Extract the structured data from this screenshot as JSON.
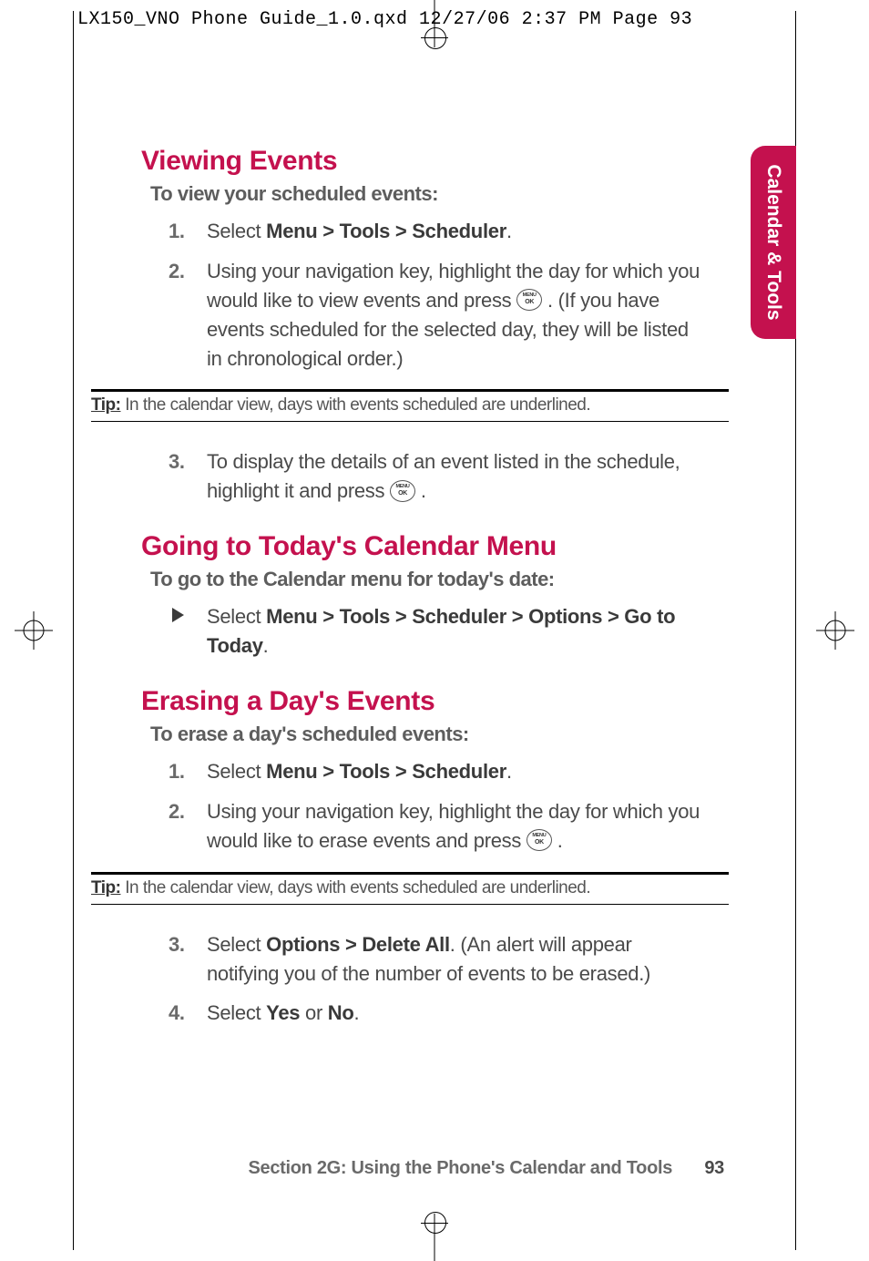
{
  "print_header": "LX150_VNO Phone Guide_1.0.qxd  12/27/06  2:37 PM  Page 93",
  "side_tab": "Calendar & Tools",
  "sections": {
    "viewing": {
      "title": "Viewing Events",
      "lead": "To view your scheduled events:",
      "step1_pre": "Select ",
      "step1_bold": "Menu > Tools > Scheduler",
      "step1_post": ".",
      "step2_a": "Using your navigation key, highlight the day for which you would like to view events and press ",
      "step2_b": ". (If you have events scheduled for the selected day, they will be listed in chronological order.)",
      "tip_label": "Tip:",
      "tip_text": " In the calendar view, days with events scheduled are underlined.",
      "step3_a": "To display the details of an event listed in the schedule, highlight it and press ",
      "step3_b": "."
    },
    "today": {
      "title": "Going to Today's Calendar Menu",
      "lead": "To go to the Calendar menu for today's date:",
      "bullet_pre": "Select ",
      "bullet_bold": "Menu > Tools > Scheduler > Options > Go to Today",
      "bullet_post": "."
    },
    "erase": {
      "title": "Erasing a Day's Events",
      "lead": "To erase a day's scheduled events:",
      "step1_pre": "Select ",
      "step1_bold": "Menu > Tools > Scheduler",
      "step1_post": ".",
      "step2_a": "Using your navigation key, highlight the day for which you would like to erase events and press ",
      "step2_b": ".",
      "tip_label": "Tip:",
      "tip_text": " In the calendar view, days with events scheduled are underlined.",
      "step3_pre": "Select ",
      "step3_bold": "Options > Delete All",
      "step3_post": ". (An alert will appear notifying you of the number of events to be erased.)",
      "step4_pre": "Select ",
      "step4_bold1": "Yes",
      "step4_mid": " or ",
      "step4_bold2": "No",
      "step4_post": "."
    }
  },
  "ok_button": {
    "top": "MENU",
    "bottom": "OK"
  },
  "footer": {
    "text": "Section 2G: Using the Phone's Calendar and Tools",
    "page": "93"
  }
}
